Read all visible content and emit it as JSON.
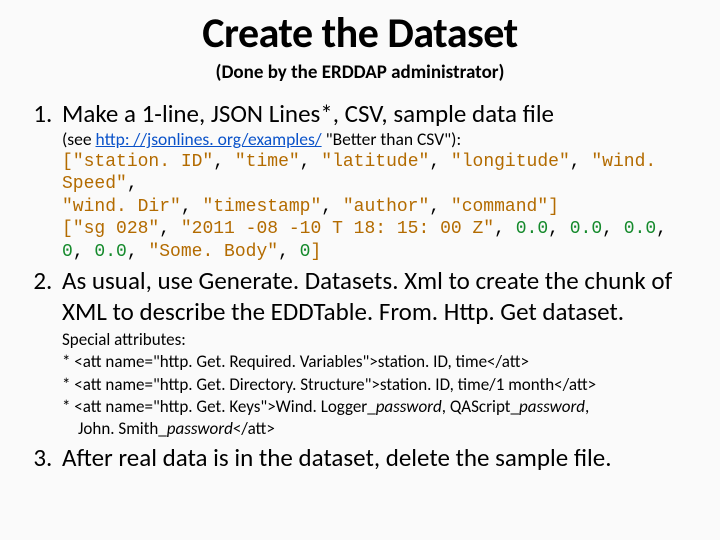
{
  "title": "Create the Dataset",
  "subtitle": "(Done by the ERDDAP administrator)",
  "items": {
    "i1": {
      "lead": "Make a 1-line, JSON Lines*, CSV, sample data file",
      "see_prefix": "(see ",
      "see_link": "http: //jsonlines. org/examples/",
      "see_suffix": " \"Better than CSV\"):",
      "code": {
        "hdr": [
          "\"station. ID\"",
          "\"time\"",
          "\"latitude\"",
          "\"longitude\"",
          "\"wind. Speed\"",
          "\"wind. Dir\"",
          "\"timestamp\"",
          "\"author\"",
          "\"command\""
        ],
        "row_str1": "\"sg 028\"",
        "row_str2": "\"2011 -08 -10 T 18: 15: 00 Z\"",
        "row_nums_a": [
          "0.0",
          "0.0",
          "0.0"
        ],
        "row_ln2_n1": "0",
        "row_ln2_n2": "0.0",
        "row_ln2_str": "\"Some. Body\"",
        "row_ln2_n3": "0"
      }
    },
    "i2": {
      "text": "As usual, use Generate. Datasets. Xml to create the chunk of XML to describe the EDDTable. From. Http. Get dataset.",
      "attrs_title": "Special attributes:",
      "a1": "* <att name=\"http. Get. Required. Variables\">station. ID, time</att>",
      "a2": "* <att name=\"http. Get. Directory. Structure\">station. ID, time/1 month</att>",
      "a3_pre": "* <att name=\"http. Get. Keys\">Wind. Logger_",
      "a3_pw1": "password",
      "a3_mid1": ", QAScript_",
      "a3_pw2": "password",
      "a3_mid2": ",",
      "a3_line2_pre": "John. Smith_",
      "a3_pw3": "password",
      "a3_line2_post": "</att>"
    },
    "i3": {
      "text": "After real data is in the dataset, delete the sample file."
    }
  }
}
